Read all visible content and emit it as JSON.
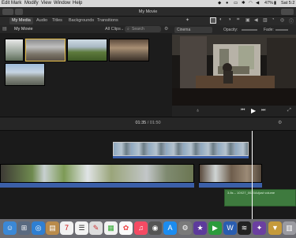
{
  "menubar": {
    "items": [
      "Edit",
      "Mark",
      "Modify",
      "View",
      "Window",
      "Help"
    ],
    "battery": "47%",
    "clock": "Sat 5:2"
  },
  "app": {
    "title": "My Movie"
  },
  "tabs": [
    "My Media",
    "Audio",
    "Titles",
    "Backgrounds",
    "Transitions"
  ],
  "library": {
    "event_name": "My Movie",
    "filter_label": "All Clips",
    "search_placeholder": "Search"
  },
  "viewer": {
    "preset_label": "Cinema",
    "opacity_label": "Opacity:",
    "fade_label": "Fade:"
  },
  "timeline": {
    "current_time": "01:35",
    "total_time": "01:50",
    "separator": "/",
    "audio_clip_left": "3.8s – 10X27_0023",
    "audio_clip_right": "Adjust volume"
  },
  "colors": {
    "selection": "#e8c04a",
    "playhead": "#ffffff",
    "audio_track": "#3e7a3e",
    "video_bar": "#3b5fa8"
  },
  "dock": {
    "icons": [
      "finder-icon",
      "launchpad-icon",
      "safari-icon",
      "notes-icon",
      "calendar-icon",
      "reminders-icon",
      "photos-icon",
      "music-icon",
      "app-store-icon",
      "system-preferences-icon",
      "imovie-icon",
      "facetime-icon",
      "word-icon",
      "downloads-icon",
      "trash-icon"
    ]
  }
}
